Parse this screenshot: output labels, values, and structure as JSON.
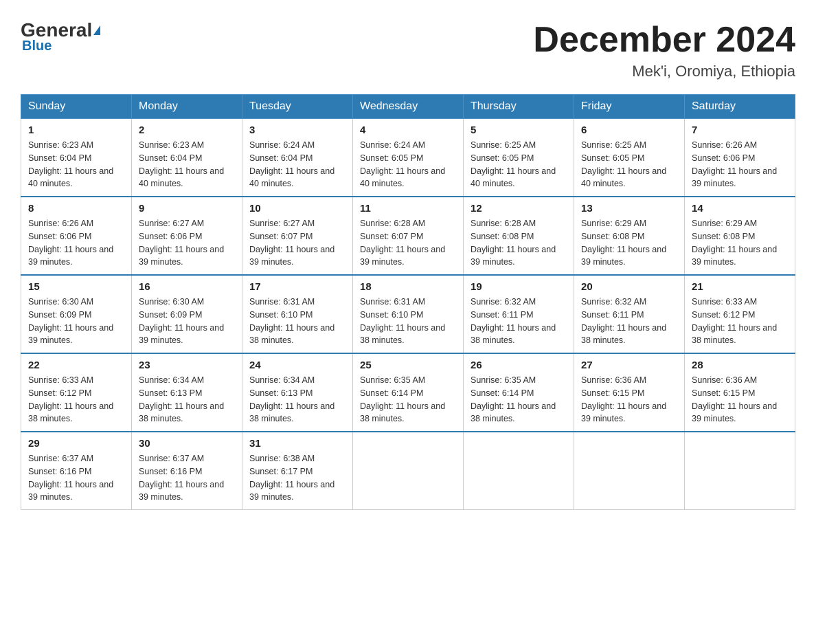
{
  "header": {
    "logo_main": "General",
    "logo_sub": "Blue",
    "month_year": "December 2024",
    "location": "Mek'i, Oromiya, Ethiopia"
  },
  "days_of_week": [
    "Sunday",
    "Monday",
    "Tuesday",
    "Wednesday",
    "Thursday",
    "Friday",
    "Saturday"
  ],
  "weeks": [
    [
      {
        "day": "1",
        "sunrise": "6:23 AM",
        "sunset": "6:04 PM",
        "daylight": "11 hours and 40 minutes."
      },
      {
        "day": "2",
        "sunrise": "6:23 AM",
        "sunset": "6:04 PM",
        "daylight": "11 hours and 40 minutes."
      },
      {
        "day": "3",
        "sunrise": "6:24 AM",
        "sunset": "6:04 PM",
        "daylight": "11 hours and 40 minutes."
      },
      {
        "day": "4",
        "sunrise": "6:24 AM",
        "sunset": "6:05 PM",
        "daylight": "11 hours and 40 minutes."
      },
      {
        "day": "5",
        "sunrise": "6:25 AM",
        "sunset": "6:05 PM",
        "daylight": "11 hours and 40 minutes."
      },
      {
        "day": "6",
        "sunrise": "6:25 AM",
        "sunset": "6:05 PM",
        "daylight": "11 hours and 40 minutes."
      },
      {
        "day": "7",
        "sunrise": "6:26 AM",
        "sunset": "6:06 PM",
        "daylight": "11 hours and 39 minutes."
      }
    ],
    [
      {
        "day": "8",
        "sunrise": "6:26 AM",
        "sunset": "6:06 PM",
        "daylight": "11 hours and 39 minutes."
      },
      {
        "day": "9",
        "sunrise": "6:27 AM",
        "sunset": "6:06 PM",
        "daylight": "11 hours and 39 minutes."
      },
      {
        "day": "10",
        "sunrise": "6:27 AM",
        "sunset": "6:07 PM",
        "daylight": "11 hours and 39 minutes."
      },
      {
        "day": "11",
        "sunrise": "6:28 AM",
        "sunset": "6:07 PM",
        "daylight": "11 hours and 39 minutes."
      },
      {
        "day": "12",
        "sunrise": "6:28 AM",
        "sunset": "6:08 PM",
        "daylight": "11 hours and 39 minutes."
      },
      {
        "day": "13",
        "sunrise": "6:29 AM",
        "sunset": "6:08 PM",
        "daylight": "11 hours and 39 minutes."
      },
      {
        "day": "14",
        "sunrise": "6:29 AM",
        "sunset": "6:08 PM",
        "daylight": "11 hours and 39 minutes."
      }
    ],
    [
      {
        "day": "15",
        "sunrise": "6:30 AM",
        "sunset": "6:09 PM",
        "daylight": "11 hours and 39 minutes."
      },
      {
        "day": "16",
        "sunrise": "6:30 AM",
        "sunset": "6:09 PM",
        "daylight": "11 hours and 39 minutes."
      },
      {
        "day": "17",
        "sunrise": "6:31 AM",
        "sunset": "6:10 PM",
        "daylight": "11 hours and 38 minutes."
      },
      {
        "day": "18",
        "sunrise": "6:31 AM",
        "sunset": "6:10 PM",
        "daylight": "11 hours and 38 minutes."
      },
      {
        "day": "19",
        "sunrise": "6:32 AM",
        "sunset": "6:11 PM",
        "daylight": "11 hours and 38 minutes."
      },
      {
        "day": "20",
        "sunrise": "6:32 AM",
        "sunset": "6:11 PM",
        "daylight": "11 hours and 38 minutes."
      },
      {
        "day": "21",
        "sunrise": "6:33 AM",
        "sunset": "6:12 PM",
        "daylight": "11 hours and 38 minutes."
      }
    ],
    [
      {
        "day": "22",
        "sunrise": "6:33 AM",
        "sunset": "6:12 PM",
        "daylight": "11 hours and 38 minutes."
      },
      {
        "day": "23",
        "sunrise": "6:34 AM",
        "sunset": "6:13 PM",
        "daylight": "11 hours and 38 minutes."
      },
      {
        "day": "24",
        "sunrise": "6:34 AM",
        "sunset": "6:13 PM",
        "daylight": "11 hours and 38 minutes."
      },
      {
        "day": "25",
        "sunrise": "6:35 AM",
        "sunset": "6:14 PM",
        "daylight": "11 hours and 38 minutes."
      },
      {
        "day": "26",
        "sunrise": "6:35 AM",
        "sunset": "6:14 PM",
        "daylight": "11 hours and 38 minutes."
      },
      {
        "day": "27",
        "sunrise": "6:36 AM",
        "sunset": "6:15 PM",
        "daylight": "11 hours and 39 minutes."
      },
      {
        "day": "28",
        "sunrise": "6:36 AM",
        "sunset": "6:15 PM",
        "daylight": "11 hours and 39 minutes."
      }
    ],
    [
      {
        "day": "29",
        "sunrise": "6:37 AM",
        "sunset": "6:16 PM",
        "daylight": "11 hours and 39 minutes."
      },
      {
        "day": "30",
        "sunrise": "6:37 AM",
        "sunset": "6:16 PM",
        "daylight": "11 hours and 39 minutes."
      },
      {
        "day": "31",
        "sunrise": "6:38 AM",
        "sunset": "6:17 PM",
        "daylight": "11 hours and 39 minutes."
      },
      null,
      null,
      null,
      null
    ]
  ]
}
